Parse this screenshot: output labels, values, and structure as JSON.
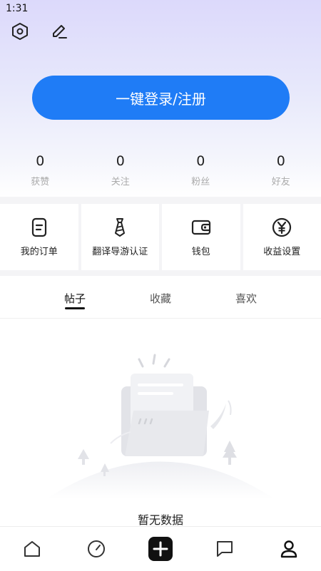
{
  "status_bar": {
    "time": "1:31"
  },
  "header": {
    "settings_icon": "hexagon-settings-icon",
    "edit_icon": "pencil-edit-icon"
  },
  "login": {
    "label": "一键登录/注册"
  },
  "stats": [
    {
      "value": "0",
      "label": "获赞"
    },
    {
      "value": "0",
      "label": "关注"
    },
    {
      "value": "0",
      "label": "粉丝"
    },
    {
      "value": "0",
      "label": "好友"
    }
  ],
  "tools": [
    {
      "label": "我的订单",
      "icon": "order-icon"
    },
    {
      "label": "翻译导游认证",
      "icon": "tie-certification-icon"
    },
    {
      "label": "钱包",
      "icon": "wallet-icon"
    },
    {
      "label": "收益设置",
      "icon": "yen-icon"
    }
  ],
  "tabs": [
    {
      "label": "帖子",
      "active": true
    },
    {
      "label": "收藏",
      "active": false
    },
    {
      "label": "喜欢",
      "active": false
    }
  ],
  "empty": {
    "text": "暂无数据"
  },
  "bottom_nav": [
    {
      "icon": "home-icon"
    },
    {
      "icon": "discover-icon"
    },
    {
      "icon": "publish-plus-icon"
    },
    {
      "icon": "message-icon"
    },
    {
      "icon": "profile-icon"
    }
  ],
  "colors": {
    "accent": "#1f7cf6",
    "dark": "#111111"
  }
}
